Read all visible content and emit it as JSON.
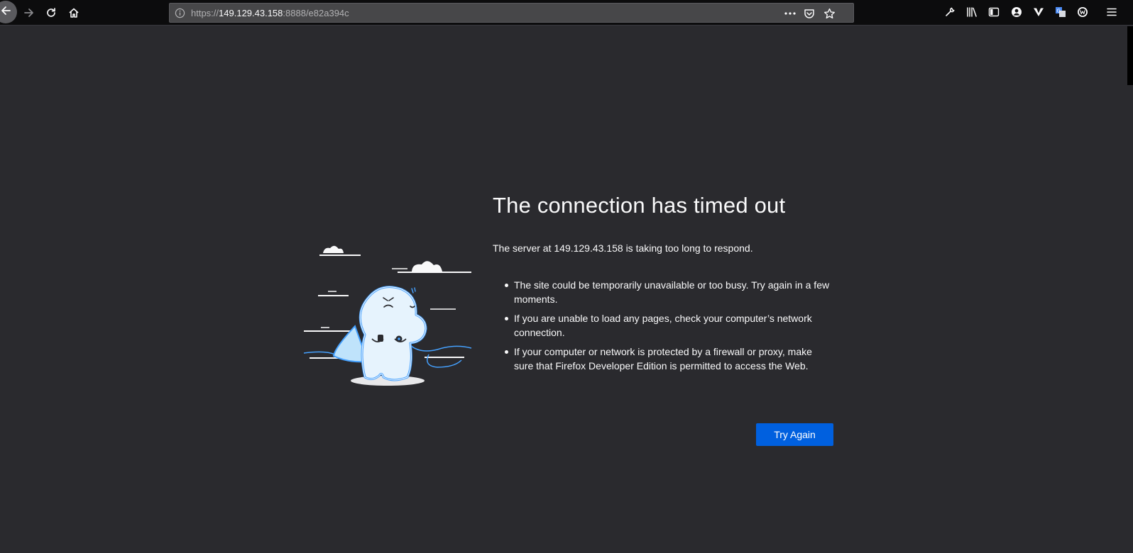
{
  "browser": {
    "url_scheme": "https://",
    "url_host": "149.129.43.158",
    "url_rest": ":8888/e82a394c",
    "icons": {
      "back": "back-arrow-icon",
      "forward": "forward-arrow-icon",
      "reload": "reload-icon",
      "home": "home-icon",
      "info": "info-icon",
      "page_actions": "more-dots-icon",
      "pocket": "pocket-icon",
      "bookmark": "star-icon",
      "devtools": "wrench-icon",
      "library": "library-icon",
      "sidebar": "sidebar-icon",
      "account": "account-icon",
      "extension1": "vivaldi-icon",
      "extension2": "translate-icon",
      "extension3": "w-circle-icon",
      "menu": "hamburger-menu-icon"
    }
  },
  "error": {
    "title": "The connection has timed out",
    "description": "The server at 149.129.43.158 is taking too long to respond.",
    "bullets": [
      "The site could be temporarily unavailable or too busy. Try again in a few moments.",
      "If you are unable to load any pages, check your computer’s network connection.",
      "If your computer or network is protected by a firewall or proxy, make sure that Firefox Developer Edition is permitted to access the Web."
    ],
    "button_label": "Try Again"
  },
  "colors": {
    "page_background": "#2a2a2e",
    "toolbar_background": "#0c0c0d",
    "urlbar_background": "#474749",
    "button_blue": "#0060df",
    "text": "#f9f9fa",
    "illustration_blue": "#45a1ff"
  }
}
